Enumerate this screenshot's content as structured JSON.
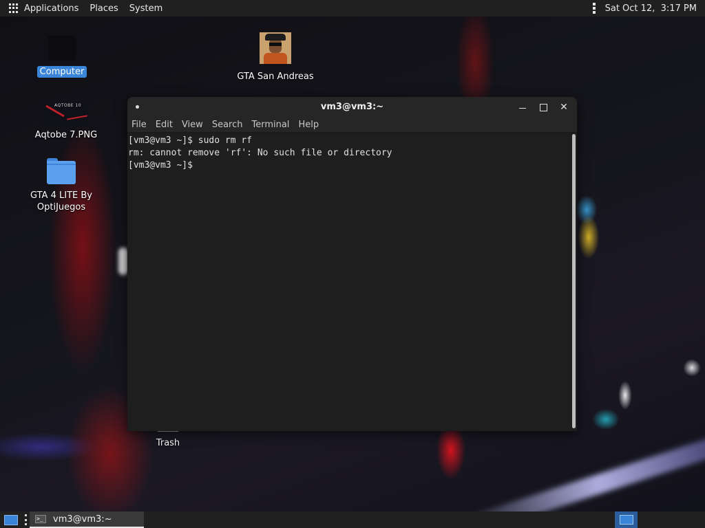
{
  "top_panel": {
    "menu": [
      "Applications",
      "Places",
      "System"
    ],
    "clock": "Sat Oct 12,  3:17 PM",
    "icons": [
      "apps-grid-icon",
      "panel-menu-dots-icon"
    ]
  },
  "desktop": {
    "icons": [
      {
        "label": "Computer",
        "icon": "computer-icon",
        "selected": true
      },
      {
        "label": "GTA San Andreas",
        "icon": "gta-san-andreas-icon"
      },
      {
        "label": "Aqtobe 7.PNG",
        "icon": "image-thumbnail-icon",
        "thumb_text": "AQTOBE 10"
      },
      {
        "label": "GTA 4 LITE By",
        "label2": "OptiJuegos",
        "icon": "folder-icon"
      },
      {
        "label": "Trash",
        "icon": "trash-icon"
      }
    ]
  },
  "terminal": {
    "title": "vm3@vm3:~",
    "menu": [
      "File",
      "Edit",
      "View",
      "Search",
      "Terminal",
      "Help"
    ],
    "lines": [
      "[vm3@vm3 ~]$ sudo rm rf",
      "rm: cannot remove 'rf': No such file or directory",
      "[vm3@vm3 ~]$"
    ]
  },
  "taskbar": {
    "task_label": "vm3@vm3:~",
    "term_icon_text": ">_"
  },
  "colors": {
    "panel_bg": "#202020",
    "selection": "#3b85d9",
    "terminal_bg": "#1e1e1e"
  }
}
